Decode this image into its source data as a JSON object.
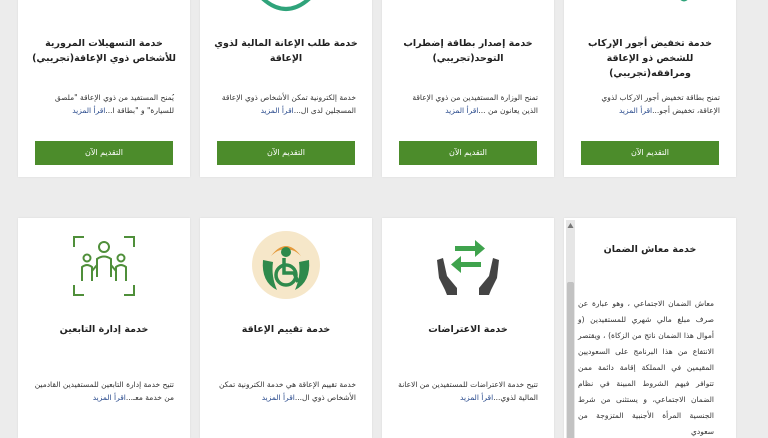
{
  "cards_top": [
    {
      "title": "خدمة التسهيلات المرورية للأشخاص ذوي الإعاقة(تجريبي)",
      "desc": "يُمنح المستفيد من ذوي الإعاقة \"ملصق للسيارة\" و \"بطاقة ا...",
      "more": "اقرأ المزيد",
      "button": "التقديم الآن"
    },
    {
      "title": "خدمة طلب الإعانة المالية لذوي الإعاقة",
      "desc": "خدمة إلكترونية تمكن الأشخاص ذوي الإعاقة المسجلين لدى ال...",
      "more": "اقرأ المزيد",
      "button": "التقديم الآن"
    },
    {
      "title": "خدمة إصدار بطاقة إضطراب التوحد(تجريبي)",
      "desc": "تمنح الوزارة المستفيدين من ذوي الإعاقة الذين يعانون من ...",
      "more": "اقرأ المزيد",
      "button": "التقديم الآن"
    },
    {
      "title": "خدمة تخفيض أجور الإركاب للشخص ذو الإعاقة ومرافقه(تجريبي)",
      "desc": "تمنح بطاقة تخفيض أجور الاركاب لذوي الإعاقة، تخفيض أجو...",
      "more": "اقرأ المزيد",
      "button": "التقديم الآن"
    }
  ],
  "cards_bottom": [
    {
      "title": "خدمة إدارة التابعين",
      "icon": "dependents-icon",
      "desc": "تتيح خدمة إدارة التابعين للمستفيدين القادمين من خدمة معـ...",
      "more": "اقرأ المزيد"
    },
    {
      "title": "خدمة تقييم الإعاقة",
      "icon": "disability-assessment-icon",
      "desc": "خدمة تقييم الإعاقة هي خدمة الكترونية تمكن الأشخاص ذوي ال...",
      "more": "اقرأ المزيد"
    },
    {
      "title": "خدمة الاعتراضات",
      "icon": "objections-hands-icon",
      "desc": "تتيح خدمة الاعتراضات للمستفيدين من الاعانة المالية لذوي...",
      "more": "اقرأ المزيد"
    }
  ],
  "scroll_card": {
    "title": "خدمة معاش الضمان",
    "desc": "معاش الضمان الاجتماعي ، وهو عبارة عن صرف مبلغ مالي شهري للمستفيدين (و أموال هذا الضمان ناتج من الزكاة) ، ويقتصر الانتفاع من هذا البرنامج على السعوديين المقيمين في المملكة إقامة دائمة ممن تتوافر فيهم الشروط المبينة في نظام الضمان الاجتماعي، و يستثنى من شرط الجنسية المرأة الأجنبية المتزوجة من سعودي"
  },
  "colors": {
    "button_green": "#4c8c2b",
    "link_blue": "#2a4b8d",
    "icon_green": "#4f8f3a"
  }
}
